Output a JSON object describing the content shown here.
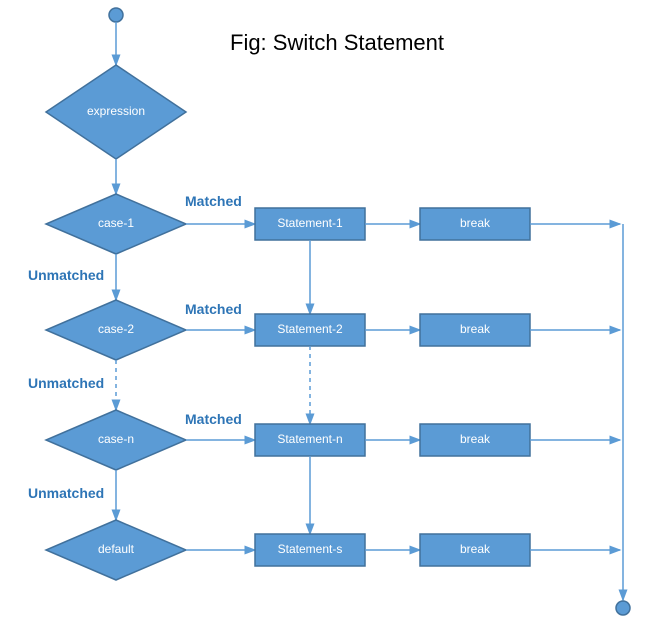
{
  "title": "Fig: Switch Statement",
  "nodes": {
    "expression": "expression",
    "case1": "case-1",
    "case2": "case-2",
    "casen": "case-n",
    "default": "default",
    "stmt1": "Statement-1",
    "stmt2": "Statement-2",
    "stmtn": "Statement-n",
    "stmts": "Statement-s",
    "break1": "break",
    "break2": "break",
    "breakn": "break",
    "breaks": "break"
  },
  "labels": {
    "matched": "Matched",
    "unmatched": "Unmatched"
  },
  "colors": {
    "fill": "#5b9bd5",
    "stroke": "#41719c",
    "text": "#ffffff",
    "edgeLabel": "#2e75b6"
  }
}
